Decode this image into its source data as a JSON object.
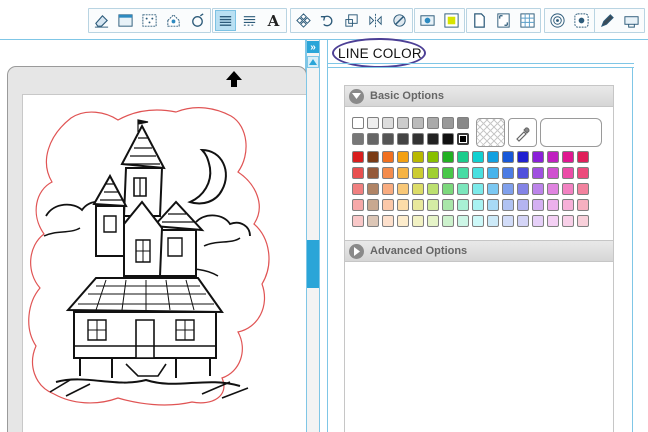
{
  "panel": {
    "title": "LINE COLOR",
    "basic_options_label": "Basic Options",
    "advanced_options_label": "Advanced Options"
  },
  "toolbar": {
    "groups": [
      [
        "eraser-icon",
        "window-icon",
        "grid-dots-icon",
        "house-icon",
        "lasso-icon"
      ],
      [
        "line-style-icon",
        "line-style-dashed-icon",
        "text-tool-icon"
      ],
      [
        "replicate-icon",
        "rotate-icon",
        "scale-icon",
        "mirror-icon",
        "knife-icon"
      ],
      [
        "library-icon",
        "fill-color-icon"
      ],
      [
        "page-setup-icon",
        "registration-marks-icon",
        "grid-icon"
      ],
      [
        "offset-icon",
        "trace-icon"
      ],
      [
        "pen-icon",
        "send-to-cutter-icon"
      ]
    ],
    "active": "line-style-icon"
  },
  "palette": {
    "gray_row_1": [
      "#ffffff",
      "#eeeeee",
      "#dddddd",
      "#cccccc",
      "#bbbbbb",
      "#aaaaaa",
      "#999999",
      "#888888"
    ],
    "gray_row_2": [
      "#777777",
      "#666666",
      "#555555",
      "#444444",
      "#333333",
      "#222222",
      "#111111",
      "#000000"
    ],
    "selected_gray": "#000000",
    "color_rows": [
      [
        "#d81e1e",
        "#7a3b16",
        "#f07020",
        "#f3a010",
        "#b8b800",
        "#88c000",
        "#22b022",
        "#1ccc8c",
        "#10d0d0",
        "#12a0e0",
        "#1858d8",
        "#2020d0",
        "#8a20d8",
        "#c020c0",
        "#e01890",
        "#e0205a"
      ],
      [
        "#e85050",
        "#955a3a",
        "#f48c4c",
        "#f6b444",
        "#cccc30",
        "#a0d030",
        "#48c848",
        "#48dca4",
        "#48e0e0",
        "#48b4ec",
        "#4c7ce4",
        "#5050dc",
        "#a050e0",
        "#d050d0",
        "#ec4ca8",
        "#ec4c7c"
      ],
      [
        "#f08080",
        "#b08466",
        "#f8ac80",
        "#f8c878",
        "#dcdc68",
        "#bce070",
        "#7cd87c",
        "#7ce6bc",
        "#7ceaea",
        "#7cc8f2",
        "#80a0ec",
        "#8484e6",
        "#bc84ea",
        "#e084e0",
        "#f282c2",
        "#f2829e"
      ],
      [
        "#f6a8a8",
        "#c8a890",
        "#fbc8a8",
        "#fcdca8",
        "#e8e89c",
        "#d4eca4",
        "#a8e6a8",
        "#a8f0d4",
        "#a8f2f2",
        "#a8daf6",
        "#b0c2f2",
        "#b4b4f0",
        "#d4b0f2",
        "#ecb0ec",
        "#f6b0d8",
        "#f6b0c0"
      ],
      [
        "#f9c8c8",
        "#dcc6b6",
        "#fde0cc",
        "#fdeccc",
        "#f2f2c4",
        "#e6f4c8",
        "#cdf2cd",
        "#cdf6e6",
        "#cdf8f8",
        "#cdeaf8",
        "#d2dcf8",
        "#d4d4f6",
        "#e6d0f8",
        "#f4d0f4",
        "#f8d0e8",
        "#f8d0da"
      ]
    ]
  }
}
